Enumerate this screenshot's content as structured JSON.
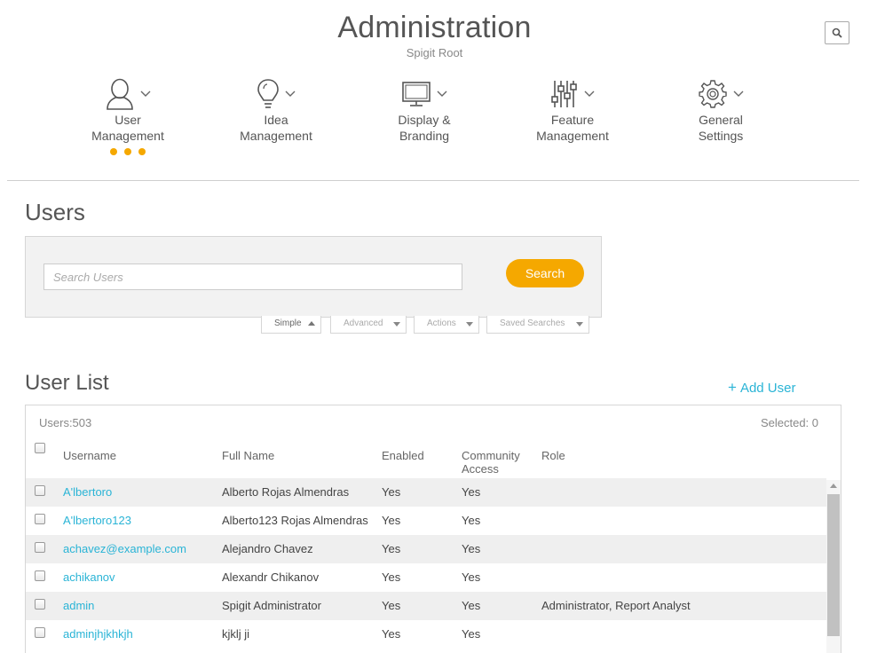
{
  "header": {
    "title": "Administration",
    "subtitle": "Spigit Root"
  },
  "nav": [
    {
      "icon": "user-icon",
      "line1": "User",
      "line2": "Management",
      "active": true
    },
    {
      "icon": "lightbulb-icon",
      "line1": "Idea",
      "line2": "Management",
      "active": false
    },
    {
      "icon": "monitor-icon",
      "line1": "Display &",
      "line2": "Branding",
      "active": false
    },
    {
      "icon": "sliders-icon",
      "line1": "Feature",
      "line2": "Management",
      "active": false
    },
    {
      "icon": "gear-icon",
      "line1": "General",
      "line2": "Settings",
      "active": false
    }
  ],
  "users_section": {
    "title": "Users",
    "search_placeholder": "Search Users",
    "search_button": "Search",
    "tabs": [
      "Simple",
      "Advanced",
      "Actions",
      "Saved Searches"
    ]
  },
  "user_list": {
    "title": "User List",
    "add_user": "Add User",
    "users_count": "Users:503",
    "selected_count": "Selected: 0",
    "columns": {
      "username": "Username",
      "full_name": "Full Name",
      "enabled": "Enabled",
      "community_access_1": "Community",
      "community_access_2": "Access",
      "role": "Role"
    },
    "rows": [
      {
        "username": "A'lbertoro",
        "full_name": "Alberto Rojas Almendras",
        "enabled": "Yes",
        "community": "Yes",
        "role": ""
      },
      {
        "username": "A'lbertoro123",
        "full_name": "Alberto123 Rojas Almendras",
        "enabled": "Yes",
        "community": "Yes",
        "role": ""
      },
      {
        "username": "achavez@example.com",
        "full_name": "Alejandro Chavez",
        "enabled": "Yes",
        "community": "Yes",
        "role": ""
      },
      {
        "username": "achikanov",
        "full_name": "Alexandr Chikanov",
        "enabled": "Yes",
        "community": "Yes",
        "role": ""
      },
      {
        "username": "admin",
        "full_name": "Spigit Administrator",
        "enabled": "Yes",
        "community": "Yes",
        "role": "Administrator, Report Analyst"
      },
      {
        "username": "adminjhjkhkjh",
        "full_name": "kjklj ji",
        "enabled": "Yes",
        "community": "Yes",
        "role": ""
      }
    ]
  },
  "colors": {
    "accent": "#f5a800",
    "link": "#2ab4d6"
  }
}
